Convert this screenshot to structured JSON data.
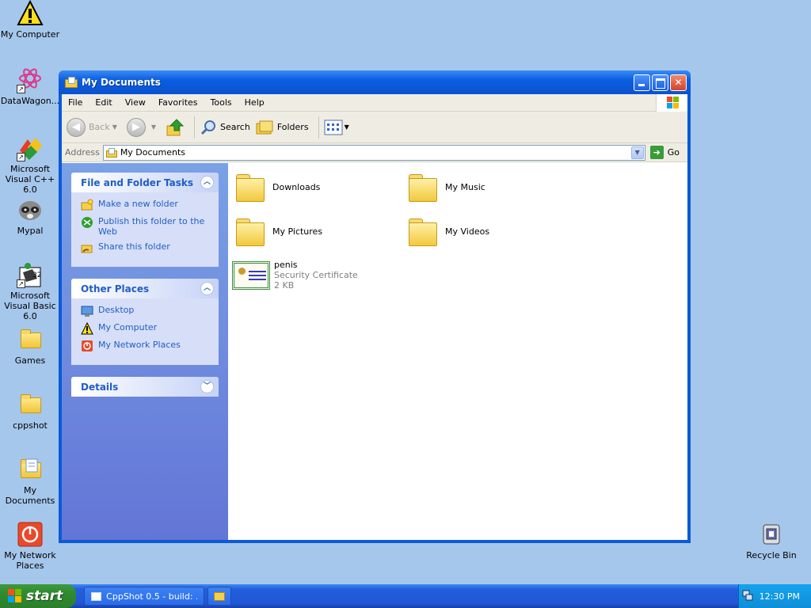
{
  "desktop": {
    "icons": [
      {
        "label": "My Computer",
        "icon": "warning-icon"
      },
      {
        "label": "DataWagon...",
        "icon": "app-shortcut-icon"
      },
      {
        "label": "Microsoft Visual C++ 6.0",
        "icon": "visual-cpp-icon"
      },
      {
        "label": "Mypal",
        "icon": "mypal-raccoon-icon"
      },
      {
        "label": "Microsoft Visual Basic 6.0",
        "icon": "visual-basic-icon"
      },
      {
        "label": "Games",
        "icon": "folder-icon"
      },
      {
        "label": "cppshot",
        "icon": "folder-icon"
      },
      {
        "label": "My Documents",
        "icon": "my-documents-icon"
      },
      {
        "label": "My Network Places",
        "icon": "network-places-icon"
      },
      {
        "label": "Recycle Bin",
        "icon": "recycle-bin-icon"
      }
    ]
  },
  "window": {
    "title": "My Documents",
    "menu": [
      "File",
      "Edit",
      "View",
      "Favorites",
      "Tools",
      "Help"
    ],
    "toolbar": {
      "back": "Back",
      "search": "Search",
      "folders": "Folders"
    },
    "address": {
      "label": "Address",
      "value": "My Documents",
      "go": "Go"
    },
    "taskpane": {
      "file_tasks": {
        "title": "File and Folder Tasks",
        "items": [
          "Make a new folder",
          "Publish this folder to the Web",
          "Share this folder"
        ]
      },
      "other_places": {
        "title": "Other Places",
        "items": [
          "Desktop",
          "My Computer",
          "My Network Places"
        ]
      },
      "details": {
        "title": "Details"
      }
    },
    "files": {
      "folders": [
        "Downloads",
        "My Music",
        "My Pictures",
        "My Videos"
      ],
      "certificate": {
        "name": "penis",
        "type": "Security Certificate",
        "size": "2 KB"
      }
    }
  },
  "taskbar": {
    "start": "start",
    "tasks": [
      "CppShot 0.5 - build: ..."
    ],
    "clock": "12:30 PM"
  },
  "colors": {
    "desktop": "#a6c7ec",
    "title_blue": "#0a5ee0",
    "link_blue": "#215dc6",
    "start_green": "#2f8a2f"
  }
}
